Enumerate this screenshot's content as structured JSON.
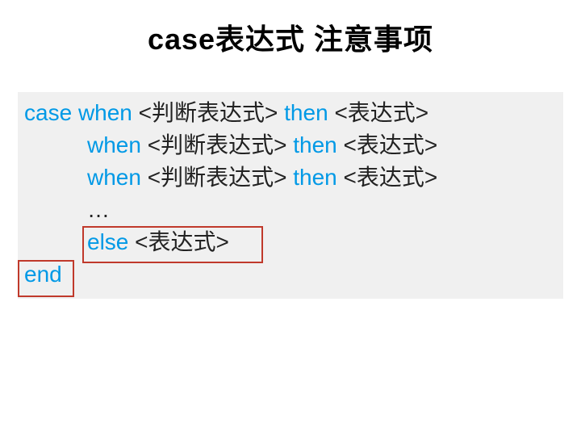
{
  "title": "case表达式 注意事项",
  "code": {
    "kw_case": "case",
    "kw_when": "when",
    "kw_then": "then",
    "kw_else": "else",
    "kw_end": "end",
    "ph_cond": "<判断表达式>",
    "ph_expr": "<表达式>",
    "ellipsis": "…"
  }
}
